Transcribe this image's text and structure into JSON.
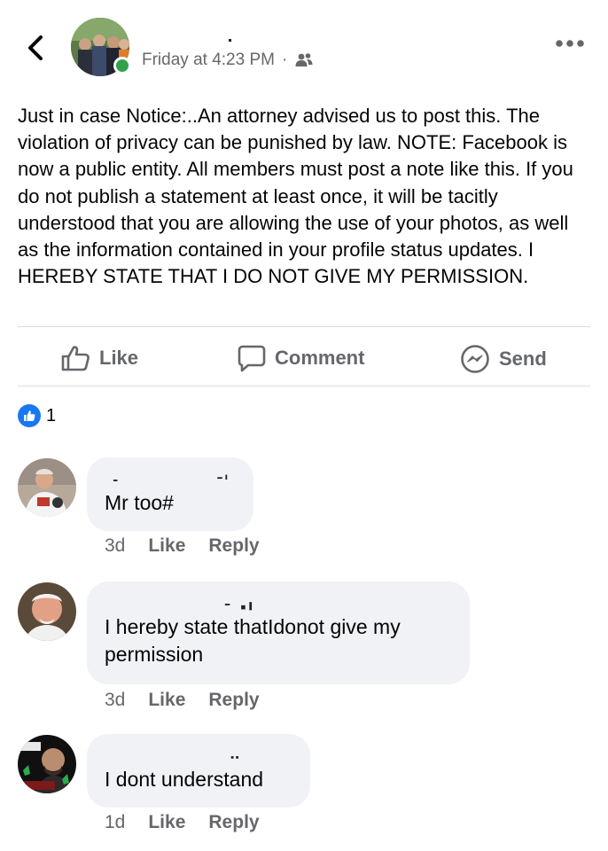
{
  "post": {
    "timestamp": "Friday at 4:23 PM",
    "separator": "·",
    "privacy_icon": "friends-icon",
    "text": "Just in case Notice:..An attorney advised us to post this. The violation of privacy can be punished by law. NOTE: Facebook is now a public entity. All members must post a note like this. If you do not publish a statement at least once, it will be tacitly understood that you are allowing the use of your photos, as well as the information contained in your profile status updates. I HEREBY STATE THAT I DO NOT GIVE MY PERMISSION."
  },
  "actions": {
    "like": "Like",
    "comment": "Comment",
    "send": "Send"
  },
  "reactions": {
    "count": "1"
  },
  "comments": [
    {
      "text": "Mr too#",
      "age": "3d",
      "like": "Like",
      "reply": "Reply"
    },
    {
      "text": "I hereby state thatIdonot give my permission",
      "age": "3d",
      "like": "Like",
      "reply": "Reply"
    },
    {
      "text": "I dont understand",
      "age": "1d",
      "like": "Like",
      "reply": "Reply"
    }
  ],
  "colors": {
    "accent": "#1877f2",
    "online": "#31a24c",
    "bubble": "#f0f2f5",
    "muted": "#65676b"
  }
}
